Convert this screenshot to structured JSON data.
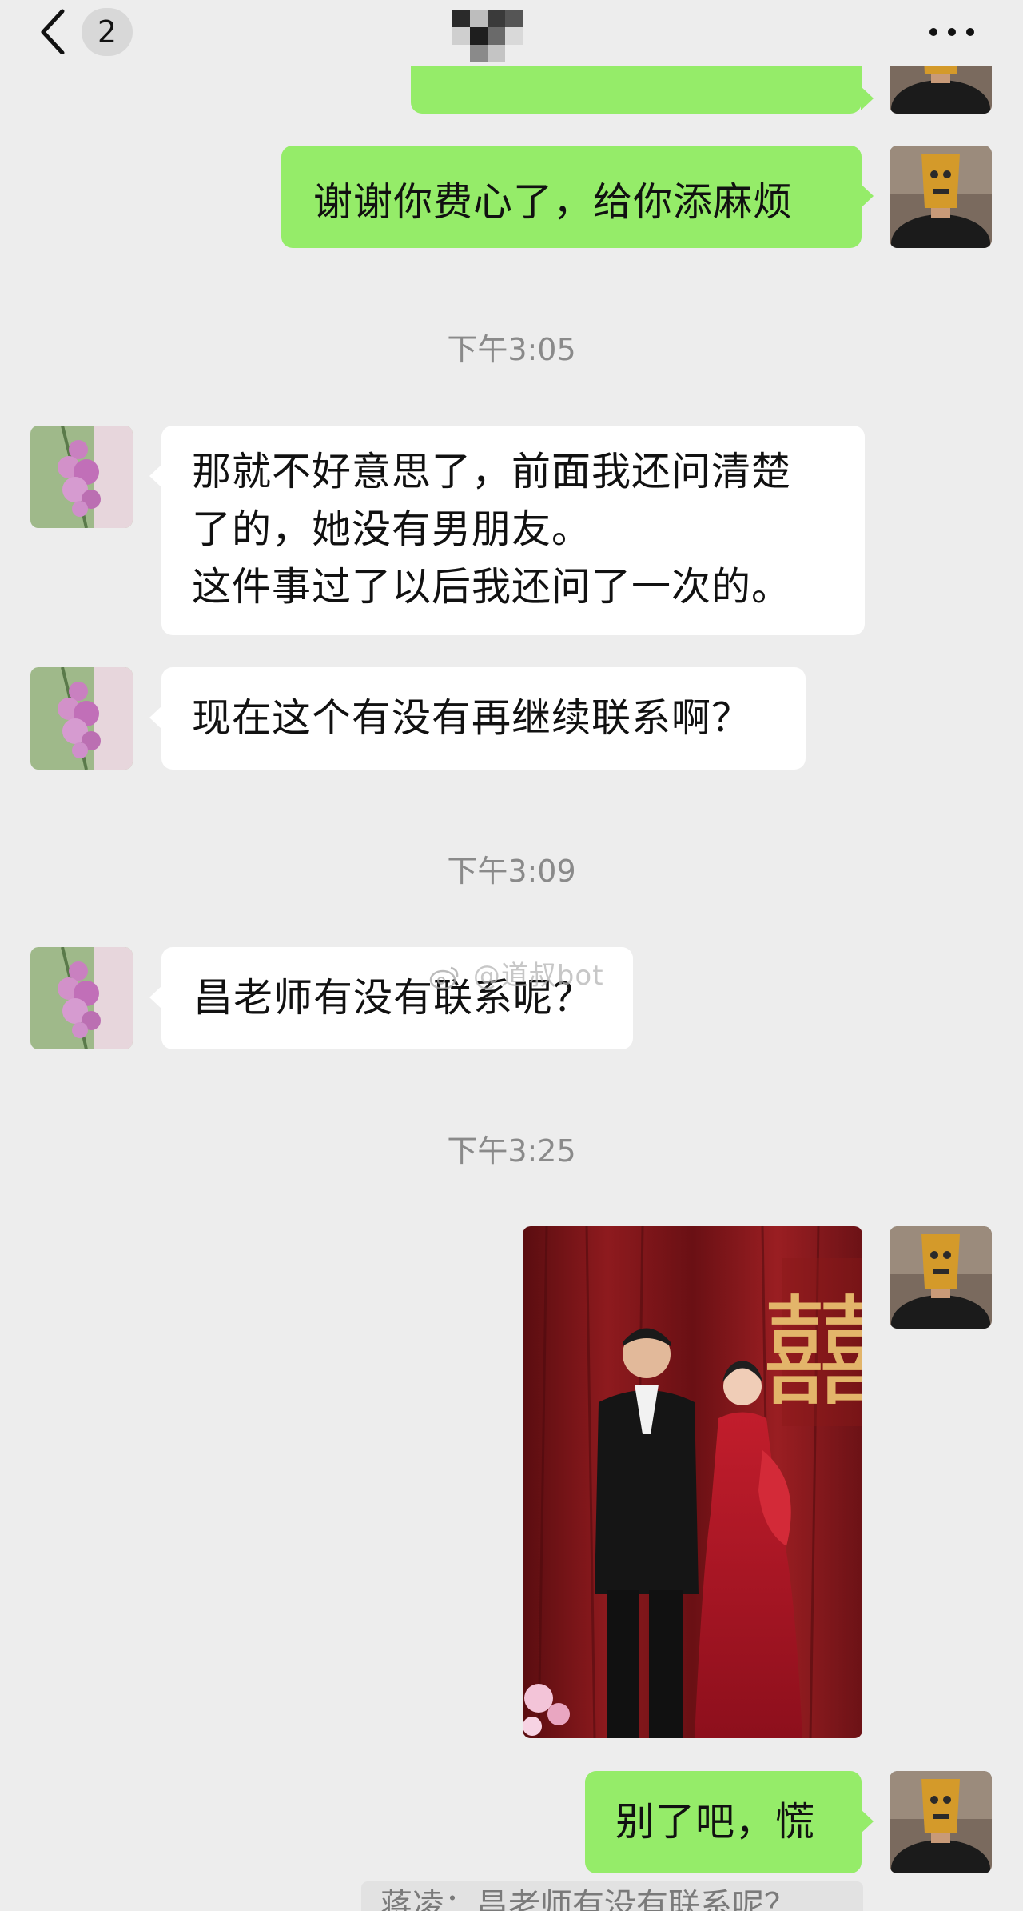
{
  "header": {
    "back_count": "2"
  },
  "messages": {
    "m1_out": "谢谢你费心了，给你添麻烦",
    "time1": "下午3:05",
    "m2_in": "那就不好意思了，前面我还问清楚\n了的，她没有男朋友。\n这件事过了以后我还问了一次的。",
    "m3_in": "现在这个有没有再继续联系啊？",
    "time2": "下午3:09",
    "m4_in": "昌老师有没有联系呢？",
    "time3": "下午3:25",
    "m5_out": "别了吧，慌",
    "quote": "蒋凌：昌老师有没有联系呢？"
  },
  "photo": {
    "sign_char": "囍"
  },
  "watermark": {
    "text": "@道叔bot"
  },
  "colors": {
    "background": "#ededed",
    "bubble_in": "#ffffff",
    "bubble_out": "#95ec69",
    "time_text": "#8a8a8a"
  },
  "icons": {
    "back": "chevron-left-icon",
    "more": "more-dots-icon",
    "avatar_left": "lilac-flower-avatar",
    "avatar_right": "masked-man-avatar"
  }
}
